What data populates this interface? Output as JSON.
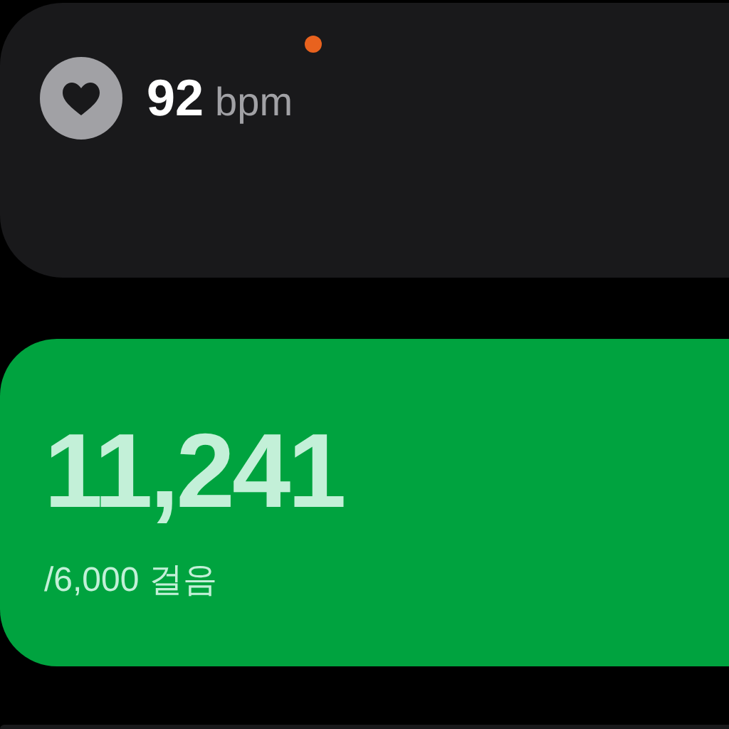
{
  "heart_rate": {
    "value": "92",
    "unit": "bpm",
    "live": true
  },
  "steps": {
    "count": "11,241",
    "goal": "/6,000 걸음",
    "goal_reached": true
  }
}
